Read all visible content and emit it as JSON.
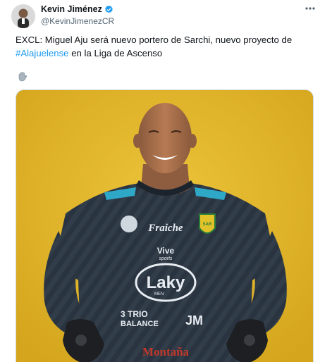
{
  "author": {
    "display_name": "Kevin Jiménez",
    "handle": "@KevinJimenezCR",
    "verified": true
  },
  "tweet": {
    "text_before": "EXCL: Miguel Aju será nuevo portero de Sarchi, nuevo proyecto de ",
    "hashtag": "#Alajuelense",
    "text_after": " en la Liga de Ascenso",
    "emoji": "🧤"
  },
  "media": {
    "background_color": "#e0b52a",
    "jersey_color": "#2a3440",
    "sponsors": [
      "Fraiche",
      "Vive sports",
      "Laky MEN",
      "TRIO BALANCE",
      "JM",
      "Montaña"
    ]
  },
  "icons": {
    "verified": "verified-badge-icon",
    "more": "more-options-icon"
  }
}
